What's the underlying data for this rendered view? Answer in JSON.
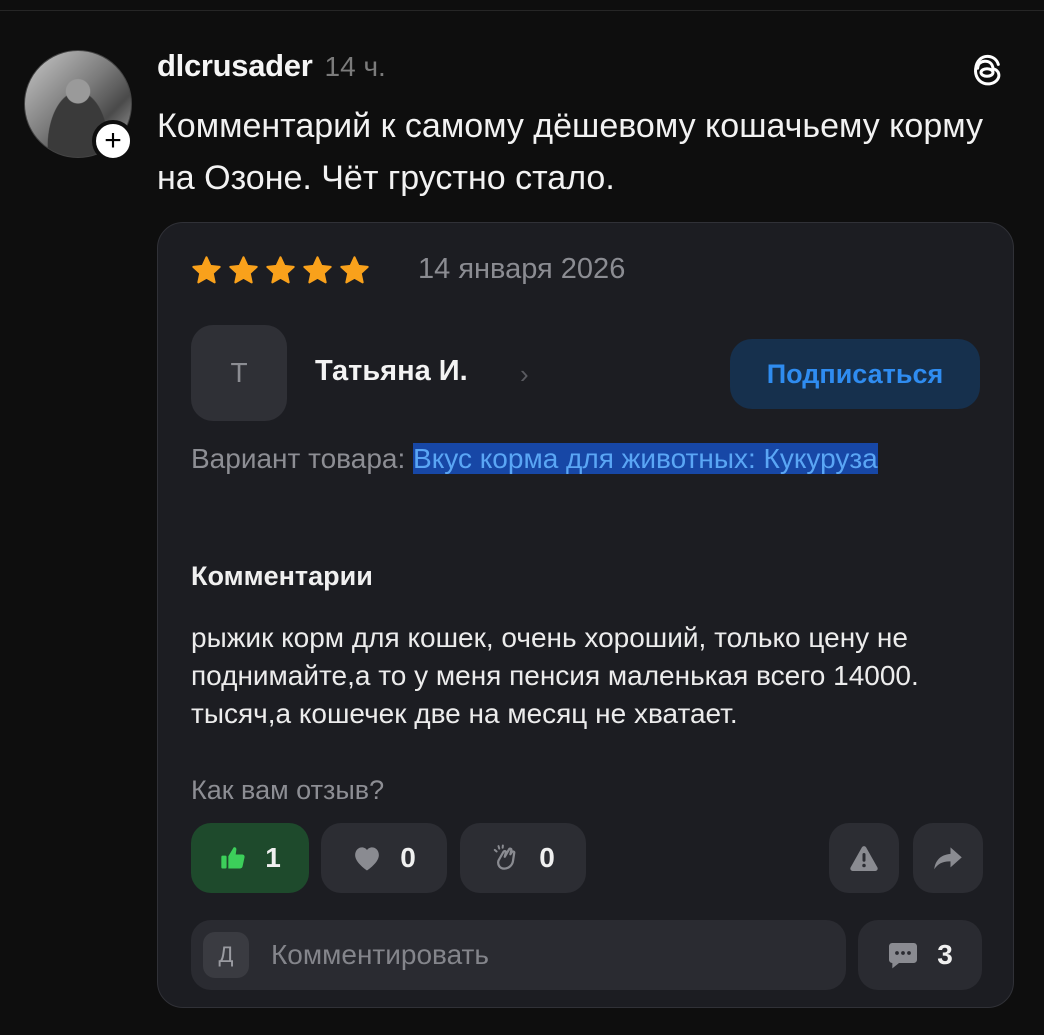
{
  "post": {
    "username": "dlcrusader",
    "time": "14 ч.",
    "text": "Комментарий к самому дёшевому кошачьему корму на Озоне. Чёт грустно стало."
  },
  "review": {
    "rating": 5,
    "rating_max": 5,
    "date": "14 января 2026",
    "user_initial": "Т",
    "user_name": "Татьяна И.",
    "subscribe_label": "Подписаться",
    "variant_label": "Вариант товара:",
    "variant_value": "Вкус корма для животных: Кукуруза",
    "comments_title": "Комментарии",
    "comment_text": "рыжик корм для кошек, очень хороший, только цену не поднимайте,а то у меня пенсия маленькая всего 14000. тысяч,а кошечек две на месяц не хватает.",
    "question": "Как вам отзыв?",
    "reactions": {
      "like": "1",
      "heart": "0",
      "clap": "0"
    },
    "input_initial": "Д",
    "input_placeholder": "Комментировать",
    "comments_count": "3"
  },
  "colors": {
    "star": "#f9a11b",
    "accent_blue": "#2f8cf0",
    "like_green": "#3ccf5a",
    "highlight": "#1747a6"
  },
  "icons": [
    "plus-icon",
    "threads-icon",
    "star-icon",
    "chevron-right-icon",
    "thumbs-up-icon",
    "heart-icon",
    "clap-icon",
    "warning-icon",
    "share-icon",
    "comment-bubble-icon"
  ]
}
